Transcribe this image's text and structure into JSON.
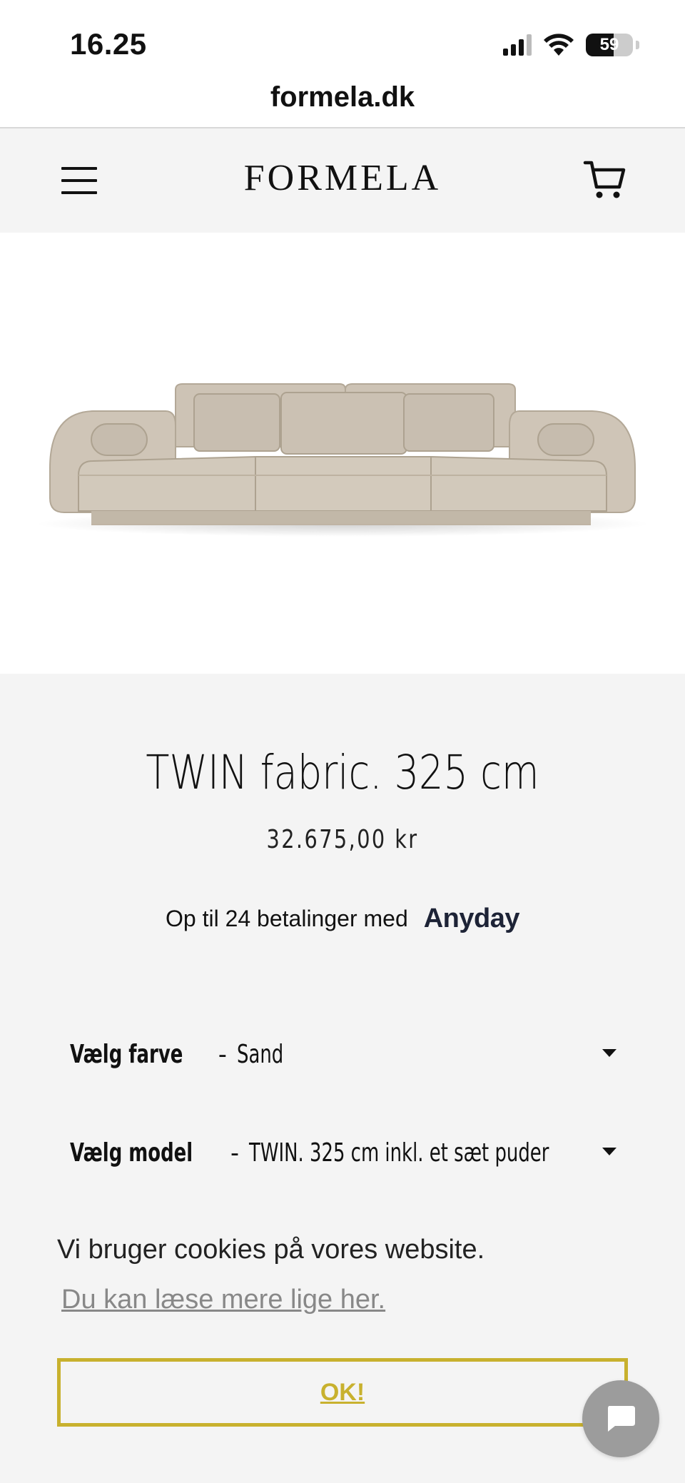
{
  "status_bar": {
    "time": "16.25",
    "battery": "59",
    "battery_level": 0.59
  },
  "browser": {
    "url": "formela.dk"
  },
  "header": {
    "logo": "FORMELA",
    "menu_icon": "hamburger-menu-icon",
    "cart_icon": "shopping-cart-icon"
  },
  "product": {
    "title": "TWIN fabric. 325 cm",
    "price": "32.675,00 kr",
    "payment_text": "Op til 24 betalinger med",
    "payment_provider": "Anyday",
    "color_option": {
      "label": "Vælg farve",
      "separator": "-",
      "value": "Sand"
    },
    "model_option": {
      "label": "Vælg model",
      "separator": "-",
      "value": "TWIN. 325 cm inkl. et sæt puder"
    },
    "sofa_color": "#cdc3b5"
  },
  "cookie_banner": {
    "text": "Vi bruger cookies på vores website.",
    "link": "Du kan læse mere lige her.",
    "button": "OK!",
    "accent": "#c8b12e"
  },
  "chat": {
    "icon": "chat-bubble-icon"
  }
}
